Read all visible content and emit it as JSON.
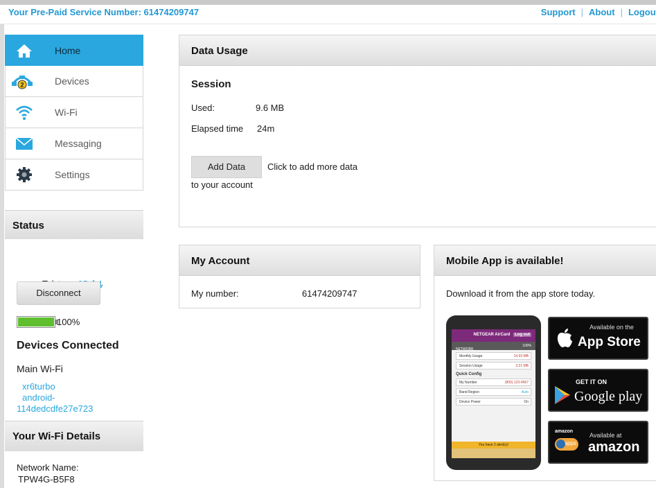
{
  "topbar": {
    "service_number": "Your Pre-Paid Service Number: 61474209747",
    "links": [
      "Support",
      "About",
      "Logout"
    ]
  },
  "nav": [
    {
      "label": "Home",
      "icon": "home-icon",
      "active": true
    },
    {
      "label": "Devices",
      "icon": "devices-icon",
      "badge": "2"
    },
    {
      "label": "Wi-Fi",
      "icon": "wifi-icon"
    },
    {
      "label": "Messaging",
      "icon": "envelope-icon"
    },
    {
      "label": "Settings",
      "icon": "gear-icon"
    }
  ],
  "status": {
    "title": "Status",
    "carrier": "Telstra",
    "network": "4G",
    "disconnect_label": "Disconnect",
    "battery_percent": "100%",
    "battery_level": 1.0,
    "devices_connected_title": "Devices Connected",
    "main_wifi": "Main Wi-Fi",
    "devices": [
      "xr6turbo",
      "android-",
      "114dedcdfe27e723"
    ]
  },
  "wifi_details": {
    "title": "Your Wi-Fi Details",
    "network_name_label": "Network Name:",
    "network_name": "TPW4G-B5F8"
  },
  "data_usage": {
    "title": "Data Usage",
    "session_title": "Session",
    "used_label": "Used:",
    "used_value": "9.6 MB",
    "elapsed_label": "Elapsed time",
    "elapsed_value": "24m",
    "add_data_label": "Add Data",
    "add_data_text_1": "Click to add more data",
    "add_data_text_2": "to your account"
  },
  "account": {
    "title": "My Account",
    "number_label": "My number:",
    "number_value": "61474209747"
  },
  "mobile_app": {
    "title": "Mobile App is available!",
    "text": "Download it from the app store today.",
    "phone": {
      "brand": "NETGEAR AirCard",
      "logout": "Log out",
      "network": "NETWORK",
      "battery": "100%",
      "monthly_usage": "Monthly Usage",
      "monthly_value": "14.93 MB",
      "session_usage": "Session Usage",
      "session_value": "3.21 MB",
      "quick_config": "Quick Config",
      "my_number": "My Number",
      "my_number_value": "(800) 123-4567",
      "band_region": "Band Region",
      "band_value": "Auto",
      "device_power": "Device Power",
      "power_value": "On",
      "alert": "You have 2 alert(s)!"
    },
    "badges": {
      "apple_small": "Available on the",
      "apple_big": "App Store",
      "google_small": "GET IT ON",
      "google_big": "Google play",
      "amazon_small_1": "amazon",
      "amazon_small_2": "apps",
      "amazon_small_3": "Available at",
      "amazon_big": "amazon"
    }
  },
  "colors": {
    "accent": "#2aa7de",
    "link": "#2199d3",
    "battery": "#5fbf2f"
  }
}
